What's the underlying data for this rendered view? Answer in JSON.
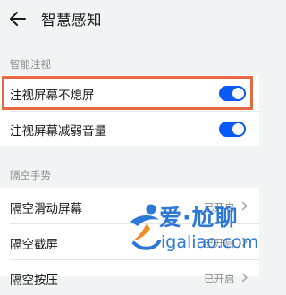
{
  "header": {
    "title": "智慧感知"
  },
  "sections": {
    "smart_gaze": {
      "label": "智能注视",
      "items": [
        {
          "label": "注视屏幕不熄屏",
          "enabled": true
        },
        {
          "label": "注视屏幕减弱音量",
          "enabled": true
        }
      ]
    },
    "air_gesture": {
      "label": "隔空手势",
      "items": [
        {
          "label": "隔空滑动屏幕",
          "status": "已开启"
        },
        {
          "label": "隔空截屏",
          "status": "已开启"
        },
        {
          "label": "隔空按压",
          "status": "已开启"
        }
      ]
    }
  },
  "watermark": {
    "title": "爱·尬聊",
    "url": "igaliao.com"
  },
  "colors": {
    "accent": "#0a59f7",
    "highlight": "#e66a41",
    "watermark": "#2c78d6"
  }
}
